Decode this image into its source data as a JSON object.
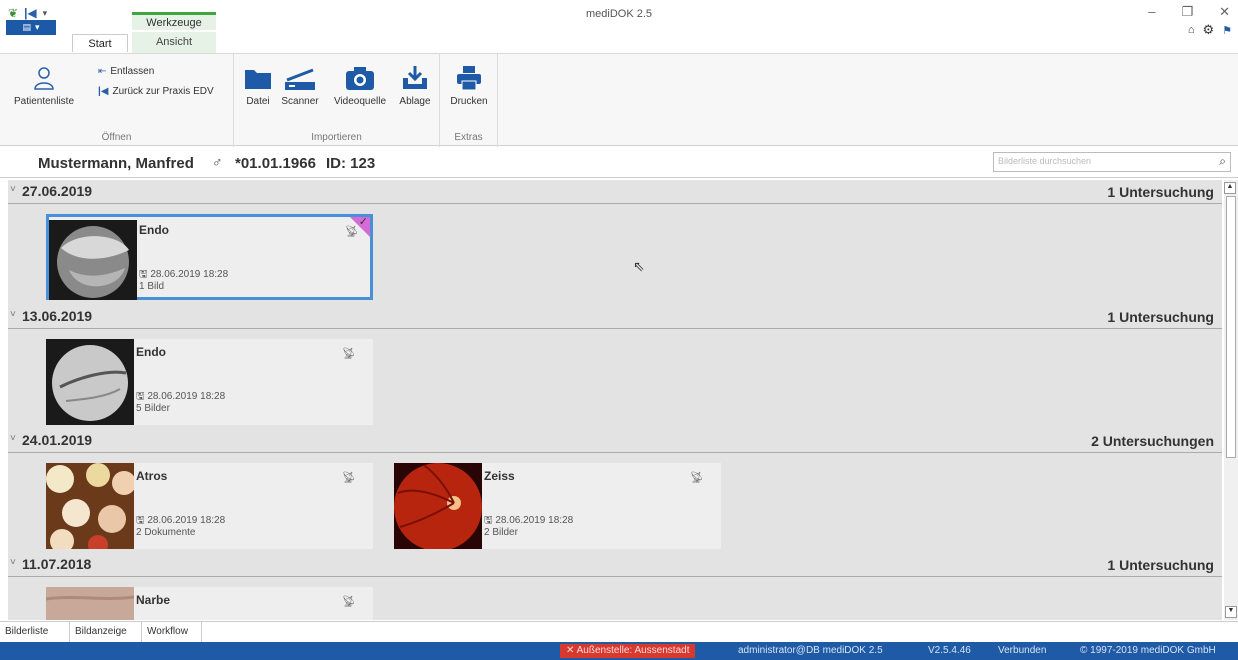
{
  "app": {
    "window_title": "mediDOK 2.5",
    "context_tab_header": "Werkzeuge",
    "tabs": [
      "Start",
      "Ansicht"
    ]
  },
  "ribbon": {
    "groups": [
      {
        "label": "Öffnen",
        "patient_list": "Patientenliste",
        "dismiss": "Entlassen",
        "back": "Zurück zur Praxis EDV"
      },
      {
        "label": "Importieren",
        "buttons": [
          "Datei",
          "Scanner",
          "Videoquelle",
          "Ablage"
        ]
      },
      {
        "label": "Extras",
        "buttons": [
          "Drucken"
        ]
      }
    ]
  },
  "patient": {
    "name": "Mustermann, Manfred",
    "sex_symbol": "♂",
    "dob": "*01.01.1966",
    "id": "ID: 123"
  },
  "search": {
    "placeholder": "Bilderliste durchsuchen"
  },
  "examinations": [
    {
      "date": "27.06.2019",
      "count": "1 Untersuchung",
      "cards": [
        {
          "title": "Endo",
          "datetime": "28.06.2019 18:28",
          "items": "1 Bild",
          "selected": true
        }
      ]
    },
    {
      "date": "13.06.2019",
      "count": "1 Untersuchung",
      "cards": [
        {
          "title": "Endo",
          "datetime": "28.06.2019 18:28",
          "items": "5 Bilder"
        }
      ]
    },
    {
      "date": "24.01.2019",
      "count": "2 Untersuchungen",
      "cards": [
        {
          "title": "Atros",
          "datetime": "28.06.2019 18:28",
          "items": "2 Dokumente"
        },
        {
          "title": "Zeiss",
          "datetime": "28.06.2019 18:28",
          "items": "2 Bilder"
        }
      ]
    },
    {
      "date": "11.07.2018",
      "count": "1 Untersuchung",
      "cards": [
        {
          "title": "Narbe"
        }
      ]
    }
  ],
  "bottom_tabs": [
    "Bilderliste",
    "Bildanzeige",
    "Workflow"
  ],
  "status": {
    "alert": "Außenstelle: Aussenstadt",
    "user": "administrator@DB mediDOK 2.5",
    "version": "V2.5.4.46",
    "connection": "Verbunden",
    "copyright": "© 1997-2019 mediDOK GmbH"
  },
  "colors": {
    "accent": "#1f5aa6",
    "context_green": "#3fa63f",
    "selection": "#4a90d9",
    "alert": "#d63a2f"
  }
}
